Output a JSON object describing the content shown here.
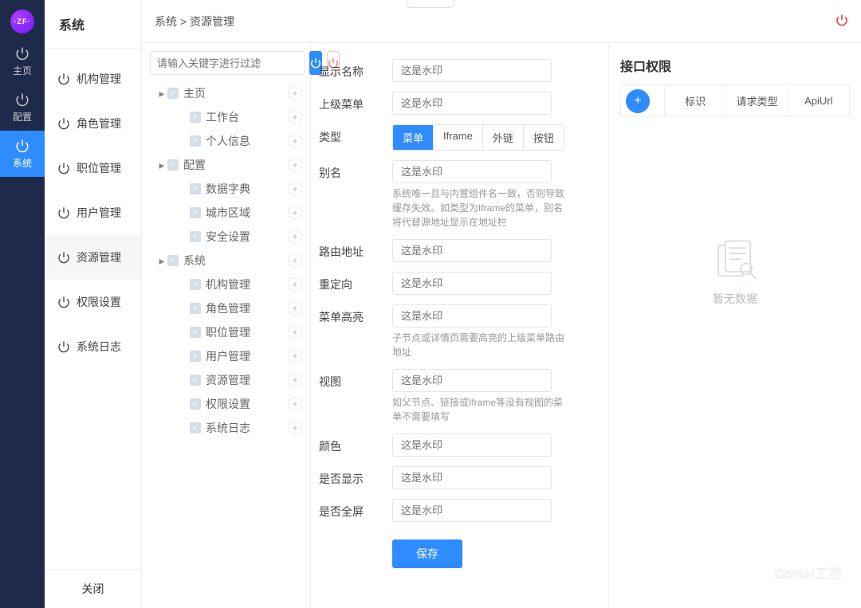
{
  "rail": {
    "brand": "·ZF·",
    "items": [
      {
        "label": "主页",
        "active": false
      },
      {
        "label": "配置",
        "active": false
      },
      {
        "label": "系统",
        "active": true
      }
    ]
  },
  "sidebar2": {
    "title": "系统",
    "items": [
      {
        "label": "机构管理"
      },
      {
        "label": "角色管理"
      },
      {
        "label": "职位管理"
      },
      {
        "label": "用户管理"
      },
      {
        "label": "资源管理",
        "active": true
      },
      {
        "label": "权限设置"
      },
      {
        "label": "系统日志"
      }
    ],
    "close": "关闭"
  },
  "breadcrumb": "系统 > 资源管理",
  "tree": {
    "filter_placeholder": "请输入关键字进行过滤",
    "nodes": [
      {
        "label": "主页",
        "level": 0,
        "caret": true
      },
      {
        "label": "工作台",
        "level": 1
      },
      {
        "label": "个人信息",
        "level": 1
      },
      {
        "label": "配置",
        "level": 0,
        "caret": true
      },
      {
        "label": "数据字典",
        "level": 1
      },
      {
        "label": "城市区域",
        "level": 1
      },
      {
        "label": "安全设置",
        "level": 1
      },
      {
        "label": "系统",
        "level": 0,
        "caret": true
      },
      {
        "label": "机构管理",
        "level": 1
      },
      {
        "label": "角色管理",
        "level": 1
      },
      {
        "label": "职位管理",
        "level": 1
      },
      {
        "label": "用户管理",
        "level": 1
      },
      {
        "label": "资源管理",
        "level": 1
      },
      {
        "label": "权限设置",
        "level": 1
      },
      {
        "label": "系统日志",
        "level": 1
      }
    ]
  },
  "form": {
    "placeholder": "这是水印",
    "labels": {
      "display_name": "显示名称",
      "parent_menu": "上级菜单",
      "type": "类型",
      "alias": "别名",
      "route": "路由地址",
      "redirect": "重定向",
      "highlight": "菜单高亮",
      "view": "视图",
      "color": "颜色",
      "show": "是否显示",
      "fullscreen": "是否全屏"
    },
    "type_options": [
      "菜单",
      "Iframe",
      "外链",
      "按钮"
    ],
    "type_active": 0,
    "hints": {
      "alias": "系统唯一且与内置组件名一致，否则导致缓存失效。如类型为Iframe的菜单，别名将代替源地址显示在地址栏",
      "highlight": "子节点或详情页需要高亮的上级菜单路由地址",
      "view": "如父节点、链接或Iframe等没有视图的菜单不需要填写"
    },
    "save": "保存"
  },
  "right": {
    "title": "接口权限",
    "cols": [
      "标识",
      "请求类型",
      "ApiUrl"
    ],
    "empty": "暂无数据"
  },
  "watermark": "Dotnet工控"
}
